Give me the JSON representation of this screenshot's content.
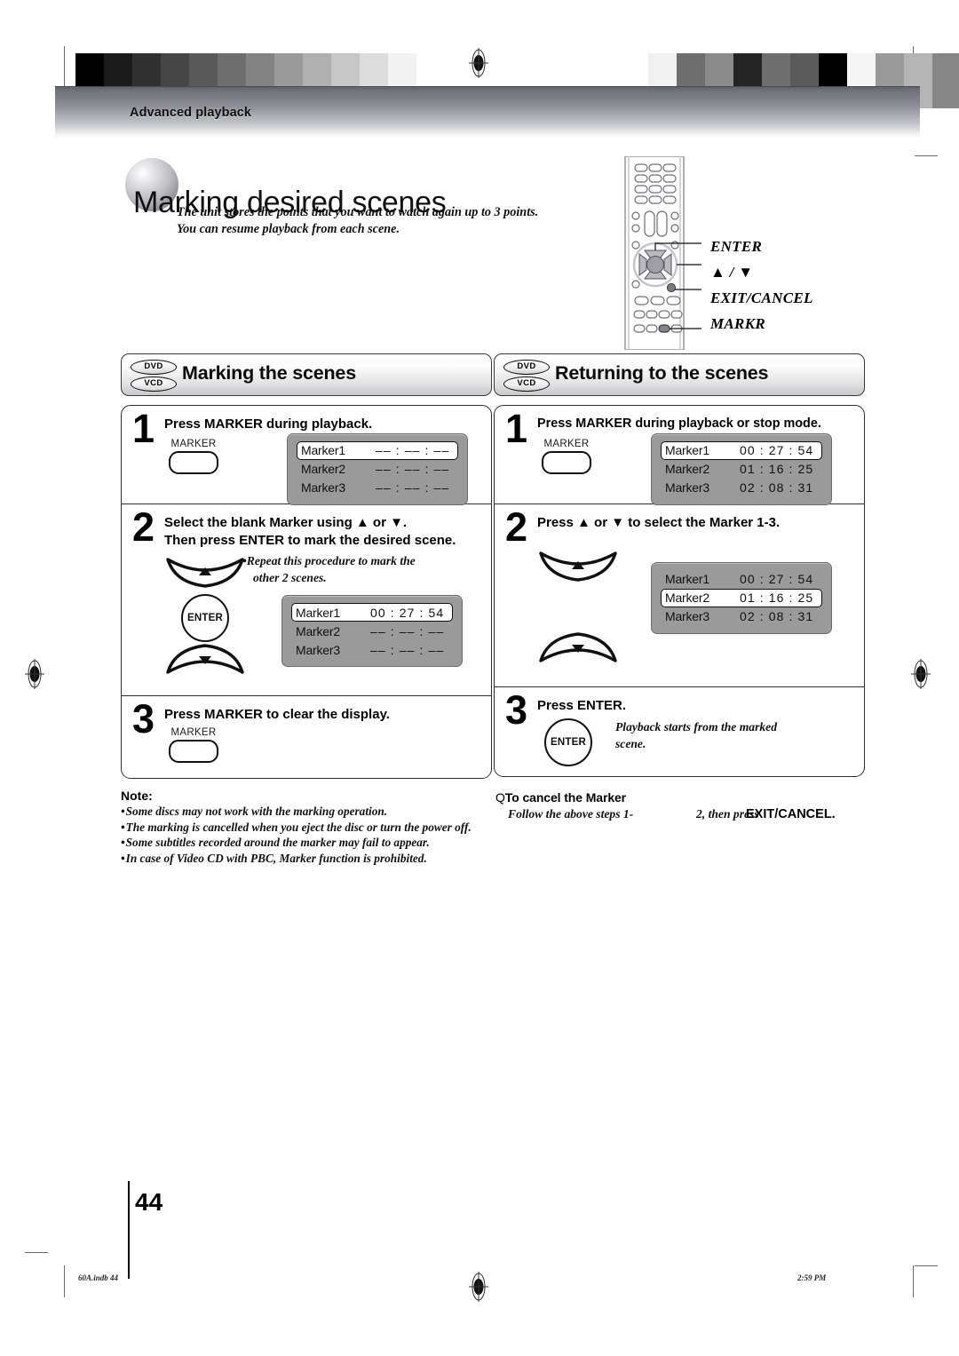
{
  "header": {
    "section_label": "Advanced playback"
  },
  "title": {
    "main": "Marking desired scenes",
    "lead_line1": "The unit stores the points that you want to watch again up to 3 points.",
    "lead_line2": "You can resume playback from each scene."
  },
  "remote": {
    "callouts": [
      "ENTER",
      "▲ / ▼",
      "EXIT/CANCEL",
      "MARKR"
    ]
  },
  "left_section": {
    "badges": [
      "DVD",
      "VCD"
    ],
    "heading": "Marking the scenes",
    "steps": [
      {
        "number": "1",
        "heading": "Press MARKER during playback.",
        "button_label": "MARKER",
        "osd": {
          "rows": [
            {
              "name": "Marker1",
              "time": "–– : –– : ––",
              "selected": true
            },
            {
              "name": "Marker2",
              "time": "–– : –– : ––",
              "selected": false
            },
            {
              "name": "Marker3",
              "time": "–– : –– : ––",
              "selected": false
            }
          ]
        }
      },
      {
        "number": "2",
        "heading_line1": "Select the blank Marker using  ▲ or ▼.",
        "heading_line2": "Then press ENTER to mark the desired scene.",
        "enter_label": "ENTER",
        "note_line1": "•Repeat this procedure to mark the",
        "note_line2": "other 2 scenes.",
        "osd": {
          "rows": [
            {
              "name": "Marker1",
              "time": "00 : 27 : 54",
              "selected": true
            },
            {
              "name": "Marker2",
              "time": "–– : –– : ––",
              "selected": false
            },
            {
              "name": "Marker3",
              "time": "–– : –– : ––",
              "selected": false
            }
          ]
        }
      },
      {
        "number": "3",
        "heading": "Press MARKER to clear the display.",
        "button_label": "MARKER"
      }
    ]
  },
  "right_section": {
    "badges": [
      "DVD",
      "VCD"
    ],
    "heading": "Returning to the scenes",
    "steps": [
      {
        "number": "1",
        "heading": "Press MARKER during playback or stop mode.",
        "button_label": "MARKER",
        "osd": {
          "rows": [
            {
              "name": "Marker1",
              "time": "00 : 27 : 54",
              "selected": true
            },
            {
              "name": "Marker2",
              "time": "01 : 16 : 25",
              "selected": false
            },
            {
              "name": "Marker3",
              "time": "02 : 08 : 31",
              "selected": false
            }
          ]
        }
      },
      {
        "number": "2",
        "heading": "Press ▲ or ▼ to select the Marker 1-3.",
        "osd": {
          "rows": [
            {
              "name": "Marker1",
              "time": "00 : 27 : 54",
              "selected": false
            },
            {
              "name": "Marker2",
              "time": "01 : 16 : 25",
              "selected": true
            },
            {
              "name": "Marker3",
              "time": "02 : 08 : 31",
              "selected": false
            }
          ]
        }
      },
      {
        "number": "3",
        "heading": "Press ENTER.",
        "enter_label": "ENTER",
        "note_line1": "Playback starts from the marked",
        "note_line2": "scene."
      }
    ]
  },
  "notes": {
    "title": "Note:",
    "items": [
      "Some discs may not work with the marking operation.",
      "The marking is cancelled when you eject the disc or turn the power off.",
      "Some subtitles recorded around the marker may fail to appear.",
      "In case of Video CD with PBC, Marker function is prohibited."
    ]
  },
  "cancel": {
    "bullet": "Q",
    "title": "To cancel the Marker",
    "line": "Follow the above steps 1-",
    "overlap": "2, then press",
    "strong": "EXIT/CANCEL."
  },
  "footer": {
    "page_number": "44",
    "left_mark": "60A.indb  44",
    "right_mark": "2:59 PM"
  },
  "colors": {
    "osd_panel": "#9a9a9a",
    "band_dark": "#5d5d68",
    "ink": "#111111"
  },
  "calibration": {
    "left_bars": [
      "#000000",
      "#1b1b1b",
      "#303030",
      "#454545",
      "#595959",
      "#6e6e6e",
      "#838383",
      "#9a9a9a",
      "#b0b0b0",
      "#c6c6c6",
      "#dcdcdc",
      "#f2f2f2",
      "#ffffff"
    ],
    "right_bars": [
      "#f0f0f0",
      "#6e6e6e",
      "#8a8a8a",
      "#242424",
      "#6e6e6e",
      "#5a5a5a",
      "#000000",
      "#f5f5f5",
      "#9a9a9a",
      "#b4b4b4",
      "#868686"
    ]
  }
}
